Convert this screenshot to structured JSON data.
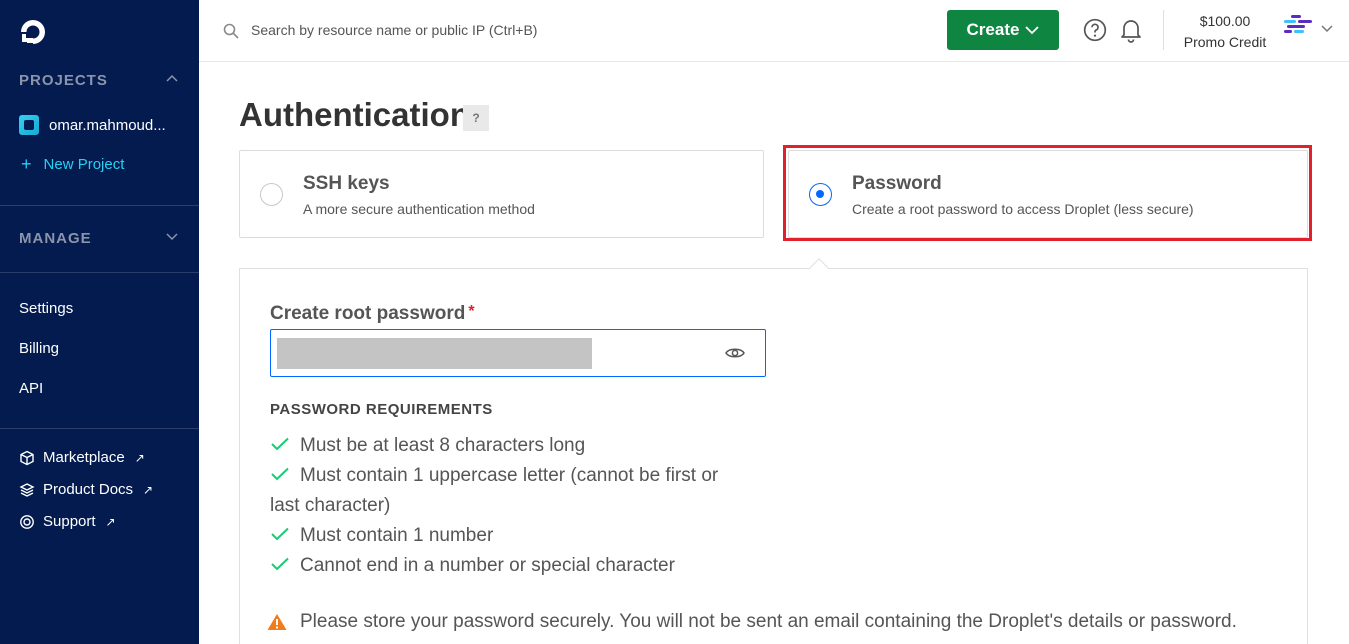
{
  "sidebar": {
    "projects_label": "PROJECTS",
    "project_name": "omar.mahmoud...",
    "new_project": "New Project",
    "manage_label": "MANAGE",
    "links": [
      "Settings",
      "Billing",
      "API"
    ],
    "external": [
      {
        "label": "Marketplace",
        "icon": "cube-icon"
      },
      {
        "label": "Product Docs",
        "icon": "layers-icon"
      },
      {
        "label": "Support",
        "icon": "lifebuoy-icon"
      }
    ]
  },
  "header": {
    "search_placeholder": "Search by resource name or public IP (Ctrl+B)",
    "create_label": "Create",
    "credit_amount": "$100.00",
    "credit_label": "Promo Credit"
  },
  "main": {
    "title": "Authentication",
    "help_badge": "?",
    "options": [
      {
        "title": "SSH keys",
        "desc": "A more secure authentication method",
        "selected": false
      },
      {
        "title": "Password",
        "desc": "Create a root password to access Droplet (less secure)",
        "selected": true
      }
    ],
    "password_label": "Create root password",
    "required_mark": "*",
    "requirements_title": "PASSWORD REQUIREMENTS",
    "requirements": [
      "Must be at least 8 characters long",
      "Must contain 1 uppercase letter (cannot be first or last character)",
      "Must contain 1 number",
      "Cannot end in a number or special character"
    ],
    "warning": "Please store your password securely. You will not be sent an email containing the Droplet's details or password."
  },
  "colors": {
    "sidebar_bg": "#031b4e",
    "accent_cyan": "#27d0f5",
    "create_green": "#0f8542",
    "selected_blue": "#0069ff",
    "highlight_red": "#e0202d",
    "check_green": "#15cd72",
    "warn_orange": "#f07c1b"
  }
}
